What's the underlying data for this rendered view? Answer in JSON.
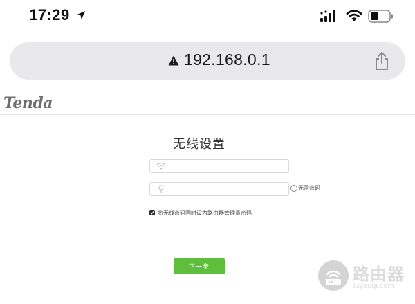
{
  "status_bar": {
    "time": "17:29",
    "icons": [
      "location-arrow-icon",
      "signal-icon",
      "wifi-icon",
      "battery-icon"
    ]
  },
  "browser": {
    "url": "192.168.0.1",
    "security_icon": "warning-triangle-icon",
    "share_icon": "share-icon"
  },
  "brand": {
    "logo_text": "Tenda"
  },
  "form": {
    "title": "无线设置",
    "ssid": {
      "icon": "wifi-icon",
      "value": "",
      "placeholder": ""
    },
    "password": {
      "icon": "lock-icon",
      "value": "",
      "placeholder": ""
    },
    "no_password_label": "无需密码",
    "no_password_checked": false,
    "sync_admin_label": "将无线密码同时设为路由器管理员密码",
    "sync_admin_checked": true,
    "next_button_label": "下一步"
  },
  "watermark": {
    "title": "路由器",
    "url": "luyouqi.com"
  },
  "colors": {
    "accent_green": "#5fbf3c",
    "address_bar_bg": "#e9e9eb",
    "logo_gray": "#6f6f6f"
  }
}
